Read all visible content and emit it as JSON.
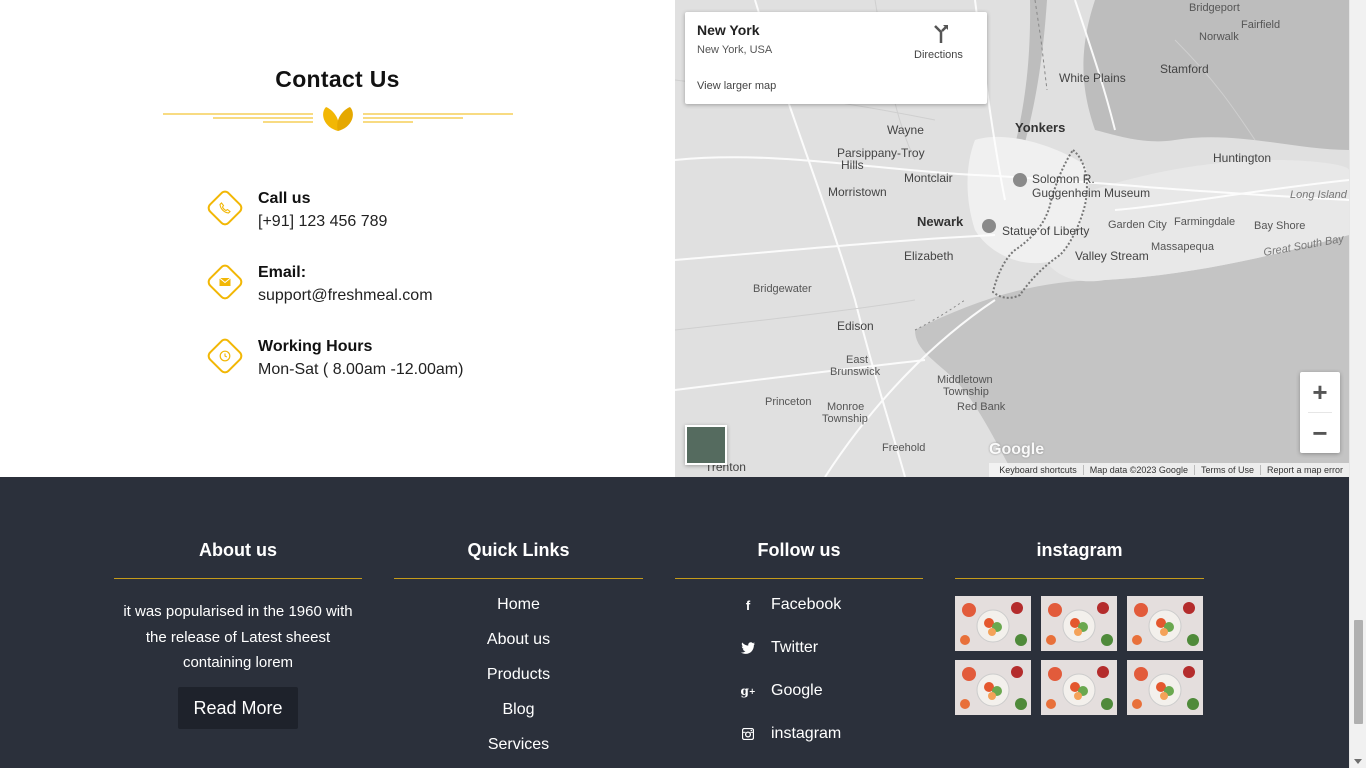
{
  "contact": {
    "title": "Contact Us",
    "items": [
      {
        "icon": "phone-icon",
        "label": "Call us",
        "value": "[+91] 123 456 789"
      },
      {
        "icon": "envelope-icon",
        "label": "Email:",
        "value": "support@freshmeal.com"
      },
      {
        "icon": "clock-icon",
        "label": "Working Hours",
        "value": "Mon-Sat ( 8.00am -12.00am)"
      }
    ]
  },
  "map": {
    "card_title": "New York",
    "card_subtitle": "New York, USA",
    "directions_label": "Directions",
    "larger_map_link": "View larger map",
    "zoom_in": "+",
    "zoom_out": "−",
    "logo": "Google",
    "attribution": {
      "shortcuts": "Keyboard shortcuts",
      "data": "Map data ©2023 Google",
      "terms": "Terms of Use",
      "report": "Report a map error"
    },
    "labels": {
      "bridgeport": "Bridgeport",
      "fairfield": "Fairfield",
      "norwalk": "Norwalk",
      "stamford": "Stamford",
      "white_plains": "White Plains",
      "wayne": "Wayne",
      "yonkers": "Yonkers",
      "huntington": "Huntington",
      "parsippany": "Parsippany-Troy",
      "hills": "Hills",
      "montclair": "Montclair",
      "solomon1": "Solomon R.",
      "solomon2": "Guggenheim Museum",
      "long_island": "Long Island",
      "morristown": "Morristown",
      "newark": "Newark",
      "statue": "Statue of Liberty",
      "garden_city": "Garden City",
      "farmingdale": "Farmingdale",
      "bay_shore": "Bay Shore",
      "elizabeth": "Elizabeth",
      "valley_stream": "Valley Stream",
      "massapequa": "Massapequa",
      "great_south_bay": "Great South Bay",
      "bridgewater": "Bridgewater",
      "edison": "Edison",
      "east": "East",
      "brunswick": "Brunswick",
      "middletown1": "Middletown",
      "middletown2": "Township",
      "princeton": "Princeton",
      "monroe1": "Monroe",
      "monroe2": "Township",
      "red_bank": "Red Bank",
      "freehold": "Freehold",
      "trenton": "Trenton"
    }
  },
  "footer": {
    "about": {
      "title": "About us",
      "text": "it was popularised in the 1960 with the release of Latest sheest containing lorem",
      "button": "Read More"
    },
    "quick_links": {
      "title": "Quick Links",
      "links": [
        "Home",
        "About us",
        "Products",
        "Blog",
        "Services"
      ]
    },
    "follow": {
      "title": "Follow us",
      "links": [
        {
          "icon": "facebook-icon",
          "label": "Facebook"
        },
        {
          "icon": "twitter-icon",
          "label": "Twitter"
        },
        {
          "icon": "google-plus-icon",
          "label": "Google"
        },
        {
          "icon": "instagram-icon",
          "label": "instagram"
        }
      ]
    },
    "instagram": {
      "title": "instagram"
    }
  },
  "colors": {
    "accent": "#f2b705",
    "footer_bg": "#2b303b",
    "footer_line": "#c59b1a"
  }
}
